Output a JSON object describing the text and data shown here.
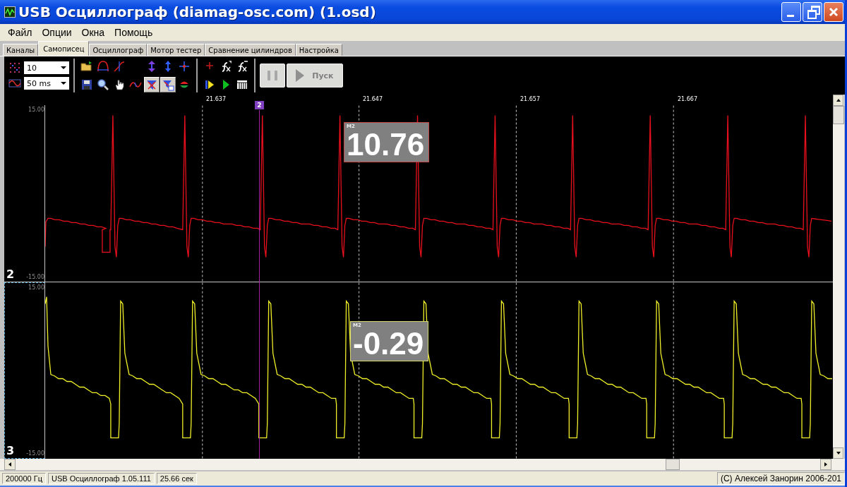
{
  "window": {
    "title": "USB Осциллограф (diamag-osc.com) (1.osd)"
  },
  "menu": [
    "Файл",
    "Опции",
    "Окна",
    "Помощь"
  ],
  "tabs": [
    {
      "label": "Каналы",
      "selected": false
    },
    {
      "label": "Самописец",
      "selected": true
    },
    {
      "label": "Осциллограф",
      "selected": false
    },
    {
      "label": "Мотор тестер",
      "selected": false
    },
    {
      "label": "Сравнение цилиндров",
      "selected": false
    },
    {
      "label": "Настройка",
      "selected": false
    }
  ],
  "toolbar": {
    "settings": [
      {
        "kind": "grid",
        "value": "10"
      },
      {
        "kind": "wave",
        "value": "50 ms"
      }
    ],
    "groups": [
      {
        "rows": [
          [
            {
              "kind": "folder",
              "pressed": false
            },
            {
              "kind": "arc",
              "pressed": false
            },
            {
              "kind": "ramp",
              "pressed": false
            },
            {
              "kind": "expand",
              "pressed": false
            },
            {
              "kind": "compress",
              "pressed": false
            },
            {
              "kind": "cross",
              "pressed": false
            }
          ],
          [
            {
              "kind": "disk",
              "pressed": false
            },
            {
              "kind": "magnifier",
              "pressed": false
            },
            {
              "kind": "hand",
              "pressed": false
            },
            {
              "kind": "sine",
              "pressed": false
            },
            {
              "kind": "filter",
              "pressed": true
            },
            {
              "kind": "filter-window",
              "pressed": true
            },
            {
              "kind": "flip",
              "pressed": false
            }
          ]
        ]
      },
      {
        "rows": [
          [
            {
              "kind": "plus",
              "pressed": false
            },
            {
              "kind": "fx",
              "pressed": false
            },
            {
              "kind": "fx-bar",
              "pressed": false
            }
          ],
          [
            {
              "kind": "step-play",
              "pressed": false
            },
            {
              "kind": "play",
              "pressed": false
            },
            {
              "kind": "columns",
              "pressed": false
            }
          ]
        ]
      }
    ],
    "pause_button": {
      "disabled": true
    },
    "run_button": {
      "label": "Пуск",
      "disabled": true
    }
  },
  "time_axis": [
    "21.637",
    "21.647",
    "21.657",
    "21.667"
  ],
  "cursor": {
    "label": "2"
  },
  "channels": [
    {
      "number": "2",
      "scale_max": "15.00",
      "scale_min": "-15.00",
      "color": "#e8101c",
      "selected": false,
      "readout": {
        "label": "M2",
        "value": "10.76"
      }
    },
    {
      "number": "3",
      "scale_max": "15.00",
      "scale_min": "-15.00",
      "color": "#f0f028",
      "selected": true,
      "readout": {
        "label": "M2",
        "value": "-0.29"
      }
    }
  ],
  "status_bar": [
    "200000  Гц",
    "USB Осциллограф 1.05.111",
    "25.66 сек",
    "(C) Алексей Занорин 2006-201"
  ]
}
